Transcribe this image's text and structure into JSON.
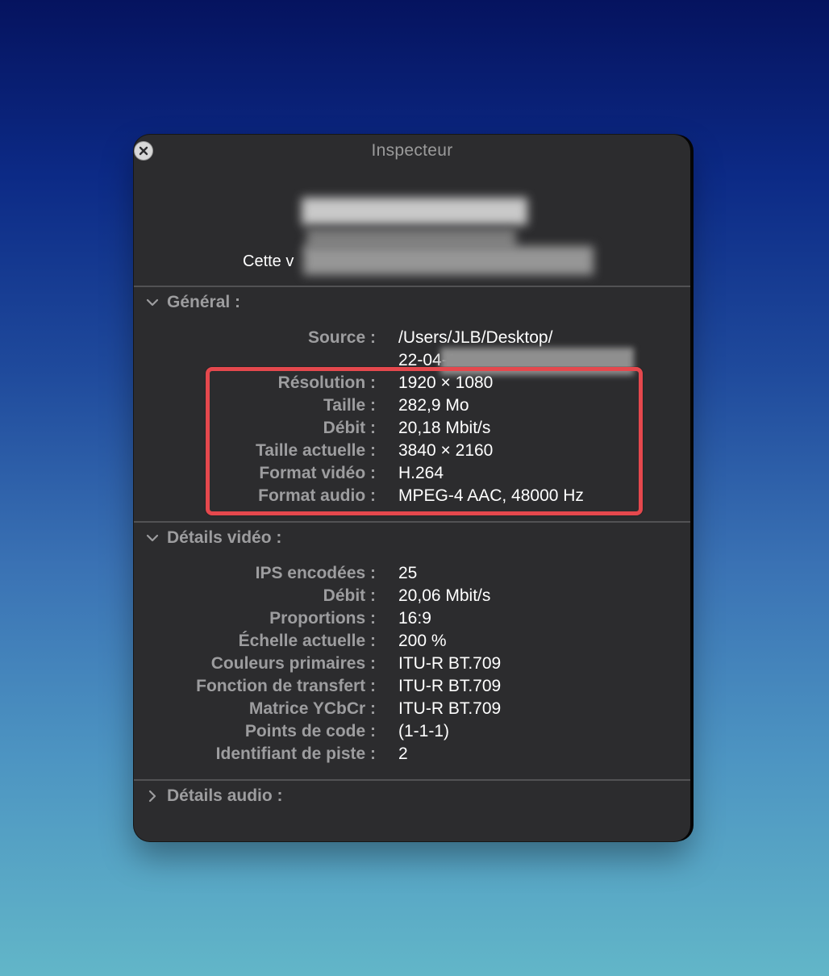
{
  "window": {
    "title": "Inspecteur",
    "header_visible_text": "Cette v"
  },
  "highlight_color": "#e5484d",
  "sections": {
    "general": {
      "title": "Général :",
      "expanded": true,
      "source_label": "Source :",
      "source_line1": "/Users/JLB/Desktop/",
      "source_line2": "22-04-1",
      "rows": [
        {
          "label": "Résolution :",
          "value": "1920 × 1080"
        },
        {
          "label": "Taille :",
          "value": "282,9 Mo"
        },
        {
          "label": "Débit :",
          "value": "20,18 Mbit/s"
        },
        {
          "label": "Taille actuelle :",
          "value": "3840 × 2160"
        },
        {
          "label": "Format vidéo :",
          "value": "H.264"
        },
        {
          "label": "Format audio :",
          "value": "MPEG-4 AAC, 48000 Hz"
        }
      ]
    },
    "video": {
      "title": "Détails vidéo :",
      "expanded": true,
      "rows": [
        {
          "label": "IPS encodées :",
          "value": "25"
        },
        {
          "label": "Débit :",
          "value": "20,06 Mbit/s"
        },
        {
          "label": "Proportions :",
          "value": "16:9"
        },
        {
          "label": "Échelle actuelle :",
          "value": "200 %"
        },
        {
          "label": "Couleurs primaires :",
          "value": "ITU-R BT.709"
        },
        {
          "label": "Fonction de transfert :",
          "value": "ITU-R BT.709"
        },
        {
          "label": "Matrice YCbCr :",
          "value": "ITU-R BT.709"
        },
        {
          "label": "Points de code :",
          "value": "(1-1-1)"
        },
        {
          "label": "Identifiant de piste :",
          "value": "2"
        }
      ]
    },
    "audio": {
      "title": "Détails audio :",
      "expanded": false
    }
  },
  "icons": {
    "close": "close-icon",
    "expanded": "chevron-down-icon",
    "collapsed": "chevron-right-icon"
  }
}
